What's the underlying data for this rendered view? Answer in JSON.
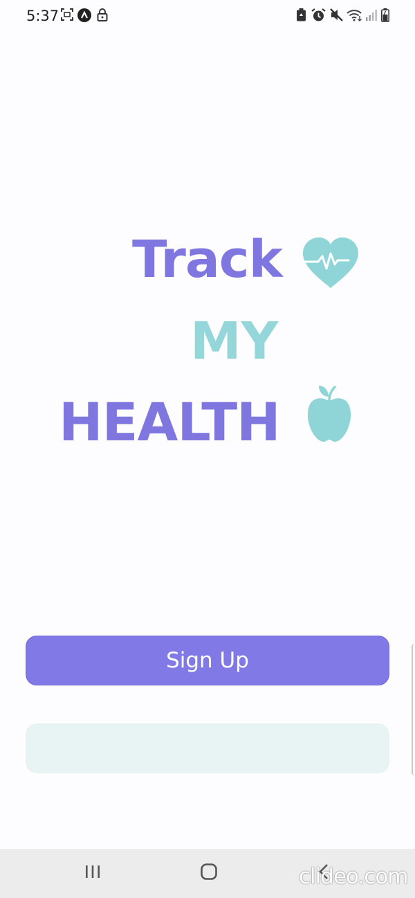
{
  "status_bar": {
    "time": "5:37",
    "left_icons": [
      "screenshot-icon",
      "app-notification-icon",
      "lock-icon"
    ],
    "right_icons": [
      "battery-saver-icon",
      "alarm-icon",
      "mute-icon",
      "wifi-icon",
      "signal-icon",
      "battery-icon"
    ]
  },
  "title": {
    "line1": "Track",
    "line2": "MY",
    "line3": "HEALTH"
  },
  "icons": {
    "heart": "heart-pulse-icon",
    "apple": "apple-icon"
  },
  "buttons": {
    "signup_label": "Sign Up",
    "secondary_label": ""
  },
  "nav_bar": {
    "items": [
      "recent-apps-icon",
      "home-icon",
      "back-icon"
    ]
  },
  "watermark": "clideo.com",
  "colors": {
    "purple": "#7f76df",
    "teal": "#94d6da",
    "button_purple": "#817ae6",
    "button_light": "#e8f4f3"
  }
}
